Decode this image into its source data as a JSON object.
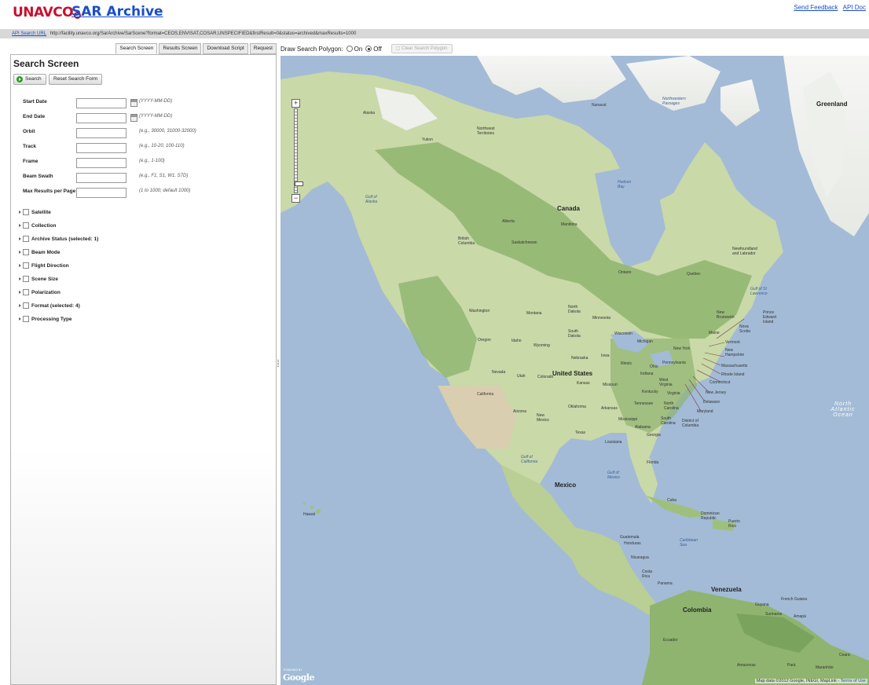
{
  "header": {
    "logo_text": "UNAVCO",
    "app_title": "SAR Archive",
    "links": [
      "Send Feedback",
      "API Doc"
    ]
  },
  "urlbar": {
    "link_label": "API Search URL",
    "url": "http://facility.unavco.org/SarArchive/SarScene?format=CEOS,ENVISAT,COSAR,UNSPECIFIED&firstResult=0&status=archived&maxResults=1000"
  },
  "tabs": [
    {
      "label": "Search Screen",
      "active": true
    },
    {
      "label": "Results Screen",
      "active": false
    },
    {
      "label": "Download Script",
      "active": false
    },
    {
      "label": "Request",
      "active": false
    }
  ],
  "search": {
    "title": "Search Screen",
    "search_button": "Search",
    "reset_button": "Reset Search Form",
    "fields": [
      {
        "label": "Start Date",
        "hint": "(YYYY-MM-DD)",
        "value": "",
        "calendar": true
      },
      {
        "label": "End Date",
        "hint": "(YYYY-MM-DD)",
        "value": "",
        "calendar": true
      },
      {
        "label": "Orbit",
        "hint": "(e.g., 30000, 31000-32000)",
        "value": "",
        "calendar": false
      },
      {
        "label": "Track",
        "hint": "(e.g., 10-20, 100-110)",
        "value": "",
        "calendar": false
      },
      {
        "label": "Frame",
        "hint": "(e.g., 1-100)",
        "value": "",
        "calendar": false
      },
      {
        "label": "Beam Swath",
        "hint": "(e.g., F1, S1, W1, S7D)",
        "value": "",
        "calendar": false
      },
      {
        "label": "Max Results per Page",
        "hint": "(1 to 1000; default 1000)",
        "value": "",
        "calendar": false
      }
    ],
    "sections": [
      "Satellite",
      "Collection",
      "Archive Status (selected: 1)",
      "Beam Mode",
      "Flight Direction",
      "Scene Size",
      "Polarization",
      "Format (selected: 4)",
      "Processing Type"
    ]
  },
  "map_toolbar": {
    "label": "Draw Search Polygon:",
    "on_label": "On",
    "off_label": "Off",
    "selected": "Off",
    "clear_button": "Clear Search Polygon"
  },
  "map": {
    "colors": {
      "water": "#a3bbd6",
      "land": "#c9d9a8",
      "forest": "#8fb46f",
      "ice": "#f4f4f2",
      "desert": "#d9cfb0"
    },
    "labels": {
      "canada": "Canada",
      "united_states": "United States",
      "mexico": "Mexico",
      "greenland": "Greenland",
      "venezuela": "Venezuela",
      "colombia": "Colombia",
      "alaska": "Alaska",
      "yukon": "Yukon",
      "nwt": "Northwest Territories",
      "nunavut": "Nunavut",
      "bc": "British Columbia",
      "alberta": "Alberta",
      "saskatchewan": "Saskatchewan",
      "manitoba": "Manitoba",
      "ontario": "Ontario",
      "quebec": "Quebec",
      "newfoundland": "Newfoundland and Labrador",
      "washington": "Washington",
      "oregon": "Oregon",
      "california": "California",
      "nevada": "Nevada",
      "idaho": "Idaho",
      "montana": "Montana",
      "wyoming": "Wyoming",
      "utah": "Utah",
      "colorado": "Colorado",
      "arizona": "Arizona",
      "new_mexico": "New Mexico",
      "texas": "Texas",
      "north_dakota": "North Dakota",
      "south_dakota": "South Dakota",
      "nebraska": "Nebraska",
      "kansas": "Kansas",
      "oklahoma": "Oklahoma",
      "minnesota": "Minnesota",
      "iowa": "Iowa",
      "missouri": "Missouri",
      "arkansas": "Arkansas",
      "louisiana": "Louisiana",
      "wisconsin": "Wisconsin",
      "illinois": "Illinois",
      "michigan": "Michigan",
      "indiana": "Indiana",
      "ohio": "Ohio",
      "kentucky": "Kentucky",
      "tennessee": "Tennessee",
      "mississippi": "Mississippi",
      "alabama": "Alabama",
      "georgia": "Georgia",
      "florida": "Florida",
      "pennsylvania": "Pennsylvania",
      "new_york": "New York",
      "virginia": "Virginia",
      "north_carolina": "North Carolina",
      "south_carolina": "South Carolina",
      "maine": "Maine",
      "vermont": "Vermont",
      "new_hampshire": "New Hampshire",
      "massachusetts": "Massachusetts",
      "rhode_island": "Rhode Island",
      "connecticut": "Connecticut",
      "new_jersey": "New Jersey",
      "delaware": "Delaware",
      "maryland": "Maryland",
      "dc": "District of Columbia",
      "west_virginia": "West Virginia",
      "new_brunswick": "New Brunswick",
      "nova_scotia": "Nova Scotia",
      "pei": "Prince Edward Island",
      "cuba": "Cuba",
      "dominican_republic": "Dominican Republic",
      "puerto_rico": "Puerto Rico",
      "guatemala": "Guatemala",
      "honduras": "Honduras",
      "nicaragua": "Nicaragua",
      "costa_rica": "Costa Rica",
      "panama": "Panama",
      "ecuador": "Ecuador",
      "guyana": "Guyana",
      "suriname": "Suriname",
      "french_guiana": "French Guiana",
      "amapa": "Amapá",
      "amazonas": "Amazonas",
      "para": "Pará",
      "maranhao": "Maranhão",
      "ceara": "Ceará",
      "hawaii": "Hawaii",
      "gulf_of_alaska": "Gulf of Alaska",
      "hudson_bay": "Hudson Bay",
      "gulf_of_mexico": "Gulf of Mexico",
      "gulf_of_california": "Gulf of California",
      "gulf_of_st_lawrence": "Gulf of St Lawrence",
      "caribbean_sea": "Caribbean Sea",
      "north_atlantic_ocean": "North Atlantic Ocean",
      "northwestern_passages": "Northwestern Passages"
    },
    "powered_by": "POWERED BY",
    "google": "Google",
    "attribution": "Map data ©2012 Google, INEGI, MapLink - ",
    "terms": "Terms of Use"
  }
}
